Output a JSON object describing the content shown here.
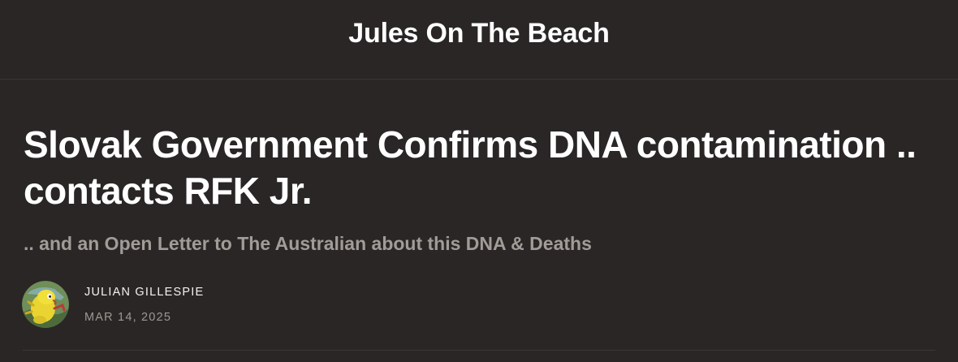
{
  "header": {
    "site_title": "Jules On The Beach"
  },
  "post": {
    "title": "Slovak Government Confirms DNA contamination .. contacts RFK Jr.",
    "subtitle": ".. and an Open Letter to The Australian about this DNA & Deaths",
    "author": "JULIAN GILLESPIE",
    "date": "MAR 14, 2025",
    "avatar_icon": "author-avatar-icon"
  },
  "colors": {
    "background": "#292625",
    "title_text": "#ffffff",
    "subtitle_text": "#a19c98",
    "date_text": "#9d9894",
    "divider": "#3a3736"
  }
}
